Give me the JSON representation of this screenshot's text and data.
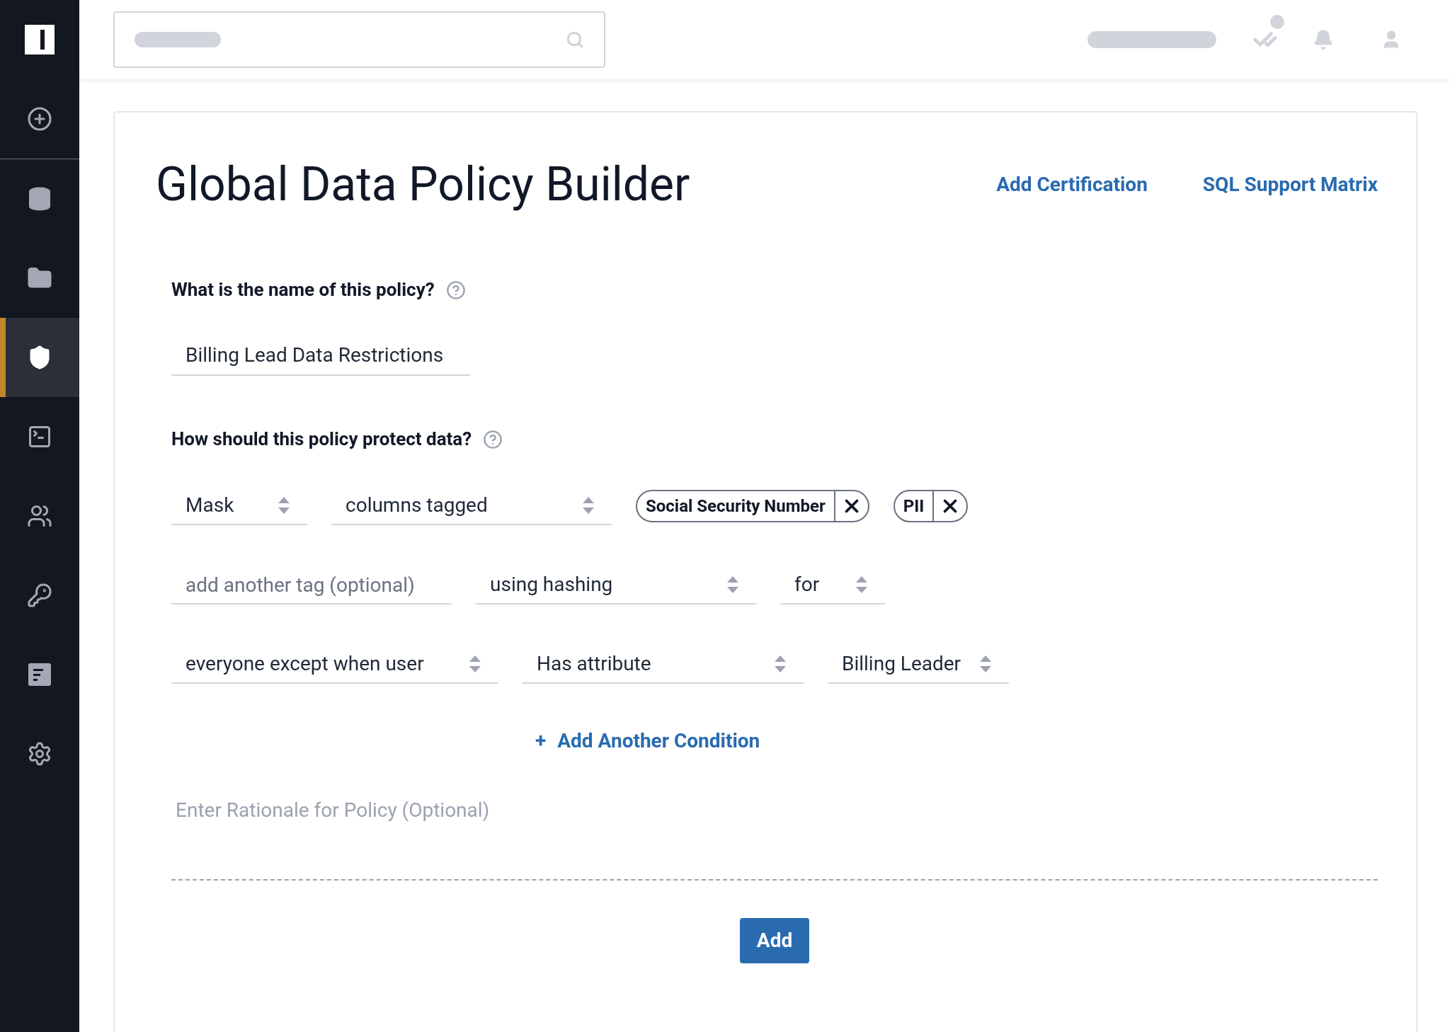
{
  "sidebar": {
    "items": [
      {
        "selected": false
      },
      {
        "selected": false
      },
      {
        "selected": false
      },
      {
        "selected": true
      },
      {
        "selected": false
      },
      {
        "selected": false
      },
      {
        "selected": false
      },
      {
        "selected": false
      },
      {
        "selected": false
      }
    ]
  },
  "page": {
    "title": "Global Data Policy Builder",
    "links": [
      "Add Certification",
      "SQL Support Matrix"
    ]
  },
  "name_question": "What is the name of this policy?",
  "name_value": "Billing Lead Data Restrictions",
  "protect_question": "How should this policy protect data?",
  "rows": [
    [
      {
        "kind": "select",
        "value": "Mask"
      },
      {
        "kind": "select",
        "value": "columns tagged"
      },
      {
        "kind": "tag",
        "value": "Social Security Number"
      },
      {
        "kind": "tag",
        "value": "PII"
      }
    ],
    [
      {
        "kind": "input",
        "placeholder": "add another tag (optional)"
      },
      {
        "kind": "select",
        "value": "using hashing"
      },
      {
        "kind": "select",
        "value": "for"
      }
    ],
    [
      {
        "kind": "select",
        "value": "everyone except when user"
      },
      {
        "kind": "select",
        "value": "Has attribute"
      },
      {
        "kind": "select",
        "value": "Billing Leader"
      }
    ]
  ],
  "add_condition": {
    "icon": "+",
    "label": "Add Another Condition"
  },
  "rationale": {
    "placeholder": "Enter Rationale for Policy (Optional)"
  },
  "submit": "Add"
}
